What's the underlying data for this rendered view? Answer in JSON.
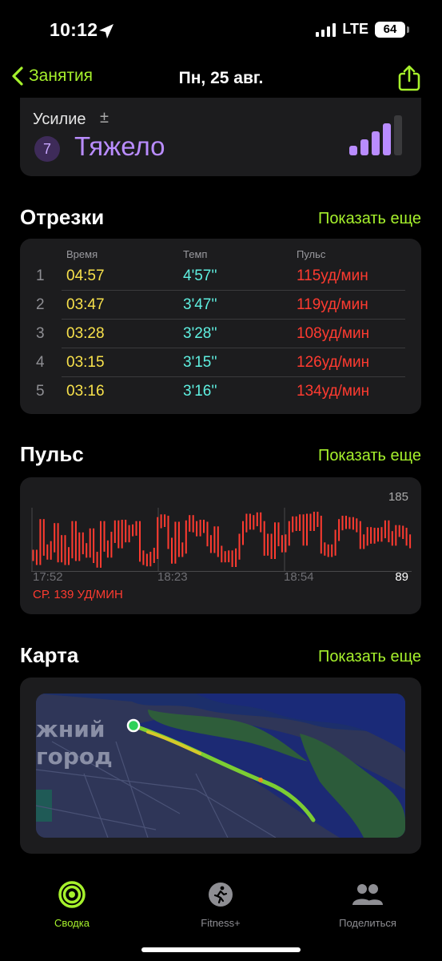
{
  "status": {
    "time": "10:12",
    "network": "LTE",
    "battery": "64"
  },
  "nav": {
    "back_label": "Занятия",
    "title": "Пн, 25 авг."
  },
  "effort": {
    "label": "Усилие",
    "adjust_symbol": "±",
    "value": "7",
    "text": "Тяжело"
  },
  "splits": {
    "title": "Отрезки",
    "show_more": "Показать еще",
    "headers": [
      "Время",
      "Темп",
      "Пульс"
    ],
    "rows": [
      {
        "index": "1",
        "time": "04:57",
        "pace": "4'57''",
        "hr": "115уд/мин"
      },
      {
        "index": "2",
        "time": "03:47",
        "pace": "3'47''",
        "hr": "119уд/мин"
      },
      {
        "index": "3",
        "time": "03:28",
        "pace": "3'28''",
        "hr": "108уд/мин"
      },
      {
        "index": "4",
        "time": "03:15",
        "pace": "3'15''",
        "hr": "126уд/мин"
      },
      {
        "index": "5",
        "time": "03:16",
        "pace": "3'16''",
        "hr": "134уд/мин"
      }
    ]
  },
  "heart": {
    "title": "Пульс",
    "show_more": "Показать еще",
    "max_label": "185",
    "min_label": "89",
    "time_labels": [
      "17:52",
      "18:23",
      "18:54"
    ],
    "average": "СР. 139 УД/МИН",
    "color": "#ff3b30"
  },
  "chart_data": {
    "type": "bar",
    "ylim": [
      89,
      185
    ],
    "values": [
      122,
      116,
      168,
      130,
      124,
      135,
      162,
      120,
      144,
      116,
      126,
      165,
      122,
      148,
      132,
      127,
      154,
      119,
      112,
      165,
      136,
      127,
      149,
      166,
      141,
      167,
      150,
      159,
      160,
      165,
      121,
      116,
      114,
      119,
      125,
      171,
      175,
      173,
      140,
      118,
      164,
      128,
      133,
      166,
      174,
      165,
      159,
      167,
      164,
      144,
      134,
      157,
      128,
      120,
      120,
      121,
      113,
      124,
      146,
      165,
      176,
      169,
      174,
      178,
      165,
      130,
      146,
      125,
      163,
      144,
      135,
      145,
      165,
      172,
      167,
      175,
      145,
      176,
      167,
      179,
      173,
      133,
      130,
      128,
      130,
      152,
      168,
      173,
      170,
      171,
      169,
      165,
      140,
      145,
      156,
      148,
      155,
      151,
      156,
      166,
      150,
      145,
      159,
      158,
      155,
      145,
      141
    ]
  },
  "map": {
    "title": "Карта",
    "show_more": "Показать еще",
    "city_line1": "жний",
    "city_line2": "город"
  },
  "tabs": [
    {
      "label": "Сводка",
      "active": true
    },
    {
      "label": "Fitness+",
      "active": false
    },
    {
      "label": "Поделиться",
      "active": false
    }
  ],
  "colors": {
    "accent": "#a6f12c",
    "effort": "#b98cff",
    "time": "#f8e14b",
    "pace": "#5ff0e1",
    "heart": "#ff3b30"
  }
}
